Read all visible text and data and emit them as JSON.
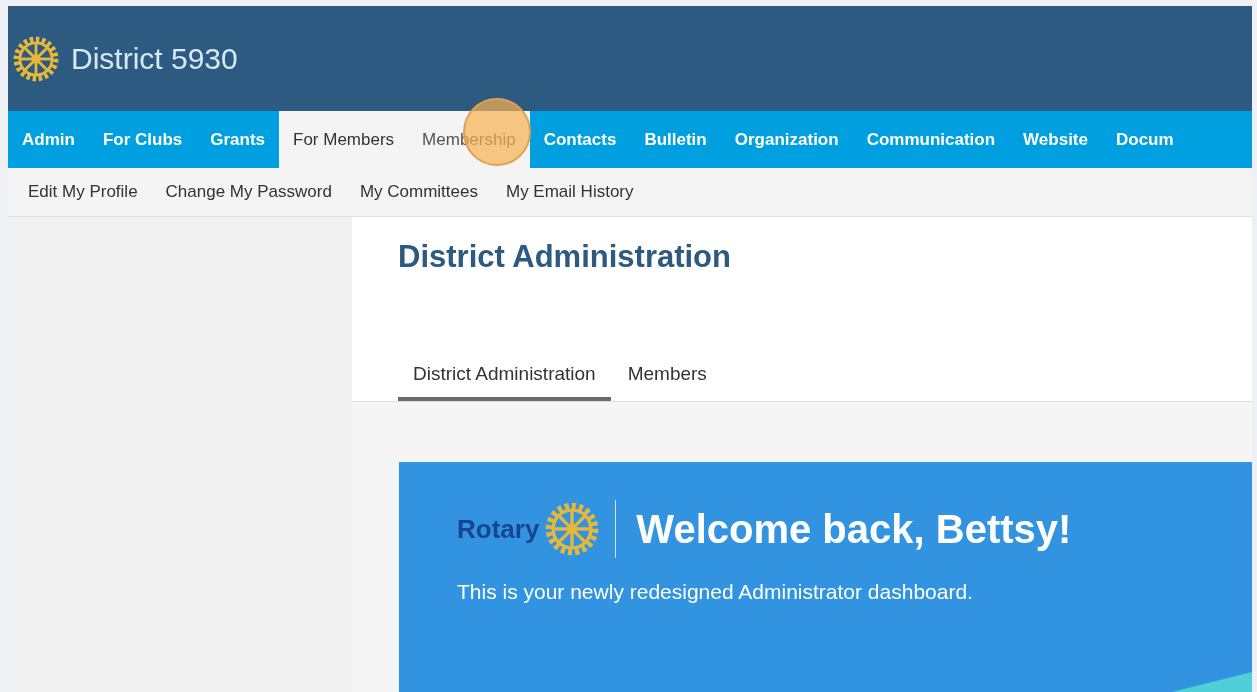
{
  "header": {
    "title": "District 5930"
  },
  "nav": [
    {
      "label": "Admin",
      "selected": false,
      "hovered": false
    },
    {
      "label": "For Clubs",
      "selected": false,
      "hovered": false
    },
    {
      "label": "Grants",
      "selected": false,
      "hovered": false
    },
    {
      "label": "For Members",
      "selected": true,
      "hovered": false
    },
    {
      "label": "Membership",
      "selected": false,
      "hovered": true
    },
    {
      "label": "Contacts",
      "selected": false,
      "hovered": false
    },
    {
      "label": "Bulletin",
      "selected": false,
      "hovered": false
    },
    {
      "label": "Organization",
      "selected": false,
      "hovered": false
    },
    {
      "label": "Communication",
      "selected": false,
      "hovered": false
    },
    {
      "label": "Website",
      "selected": false,
      "hovered": false
    },
    {
      "label": "Docum",
      "selected": false,
      "hovered": false
    }
  ],
  "subnav": [
    "Edit My Profile",
    "Change My Password",
    "My Committees",
    "My Email History"
  ],
  "page": {
    "title": "District Administration",
    "tabs": [
      {
        "label": "District Administration",
        "selected": true
      },
      {
        "label": "Members",
        "selected": false
      }
    ],
    "welcome": {
      "brand": "Rotary",
      "heading": "Welcome back, Bettsy!",
      "text": "This is your newly redesigned Administrator dashboard."
    }
  }
}
